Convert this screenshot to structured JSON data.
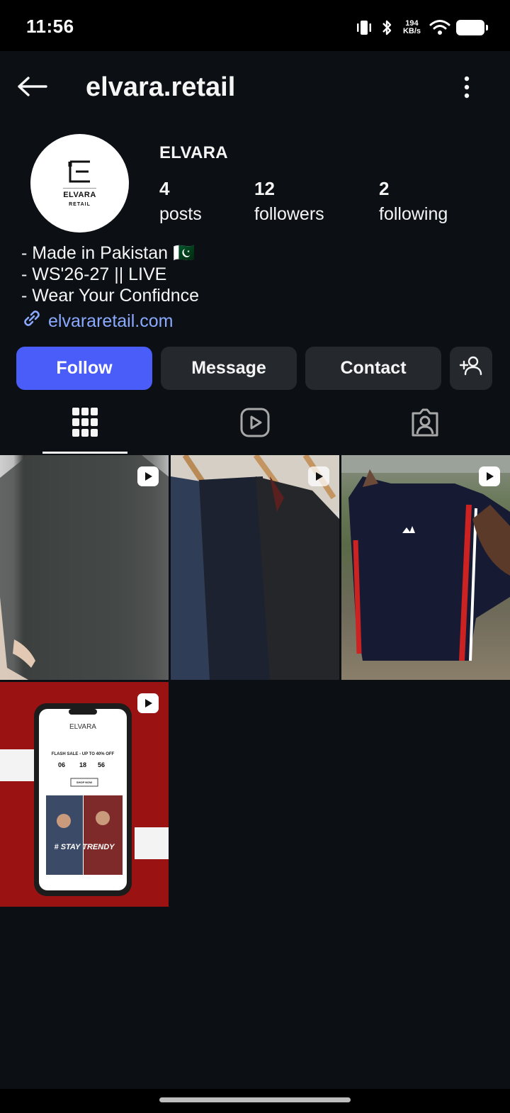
{
  "status_bar": {
    "time": "11:56",
    "net_speed_value": "194",
    "net_speed_unit": "KB/s"
  },
  "header": {
    "username": "elvara.retail",
    "back_icon": "arrow-left-icon",
    "more_icon": "more-vertical-icon"
  },
  "profile": {
    "avatar_brand": "ELVARA",
    "avatar_sub": "RETAIL",
    "display_name": "ELVARA",
    "stats": [
      {
        "value": "4",
        "label": "posts"
      },
      {
        "value": "12",
        "label": "followers"
      },
      {
        "value": "2",
        "label": "following"
      }
    ],
    "bio": [
      "- Made in Pakistan 🇵🇰",
      "- WS'26-27 || LIVE",
      "- Wear Your Confidnce"
    ],
    "link": "elvararetail.com"
  },
  "actions": {
    "follow": "Follow",
    "message": "Message",
    "contact": "Contact",
    "add_user_icon": "add-person-icon"
  },
  "tabs": [
    {
      "icon": "grid-icon",
      "active": true
    },
    {
      "icon": "reels-icon",
      "active": false
    },
    {
      "icon": "tagged-icon",
      "active": false
    }
  ],
  "posts": [
    {
      "type": "reel"
    },
    {
      "type": "reel"
    },
    {
      "type": "reel"
    },
    {
      "type": "reel",
      "overlay_texts": [
        "ELVARA",
        "FLASH SALE - UP TO 40% OFF",
        "06",
        "18",
        "56",
        "SHOP NOW",
        "# STAY TRENDY"
      ]
    }
  ],
  "colors": {
    "background": "#0c1014",
    "primary_button": "#4a5df9",
    "secondary_button": "#25292e",
    "link": "#8aa9ff"
  }
}
